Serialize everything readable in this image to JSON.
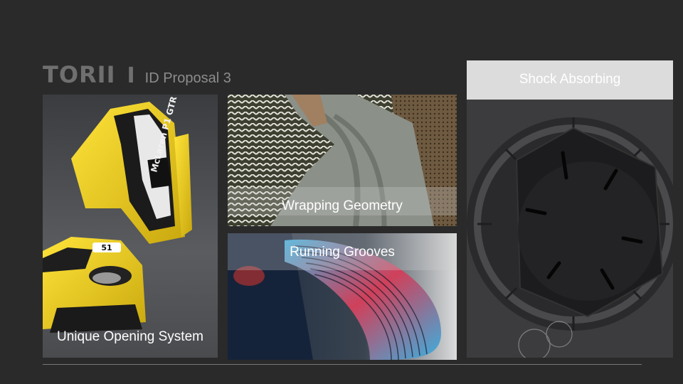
{
  "header": {
    "brand": "TORII",
    "separator": "I",
    "subtitle": "ID Proposal 3"
  },
  "panels": {
    "car": {
      "caption": "Unique Opening System",
      "badge_number": "51",
      "car_text": "McLaren P1 GTR"
    },
    "wrapping": {
      "caption": "Wrapping Geometry"
    },
    "grooves": {
      "caption": "Running Grooves"
    },
    "shock": {
      "caption": "Shock Absorbing"
    }
  },
  "colors": {
    "background": "#2a2a2a",
    "title": "#6f6f6f",
    "car_yellow": "#f2d21a",
    "caption": "#ffffff"
  }
}
